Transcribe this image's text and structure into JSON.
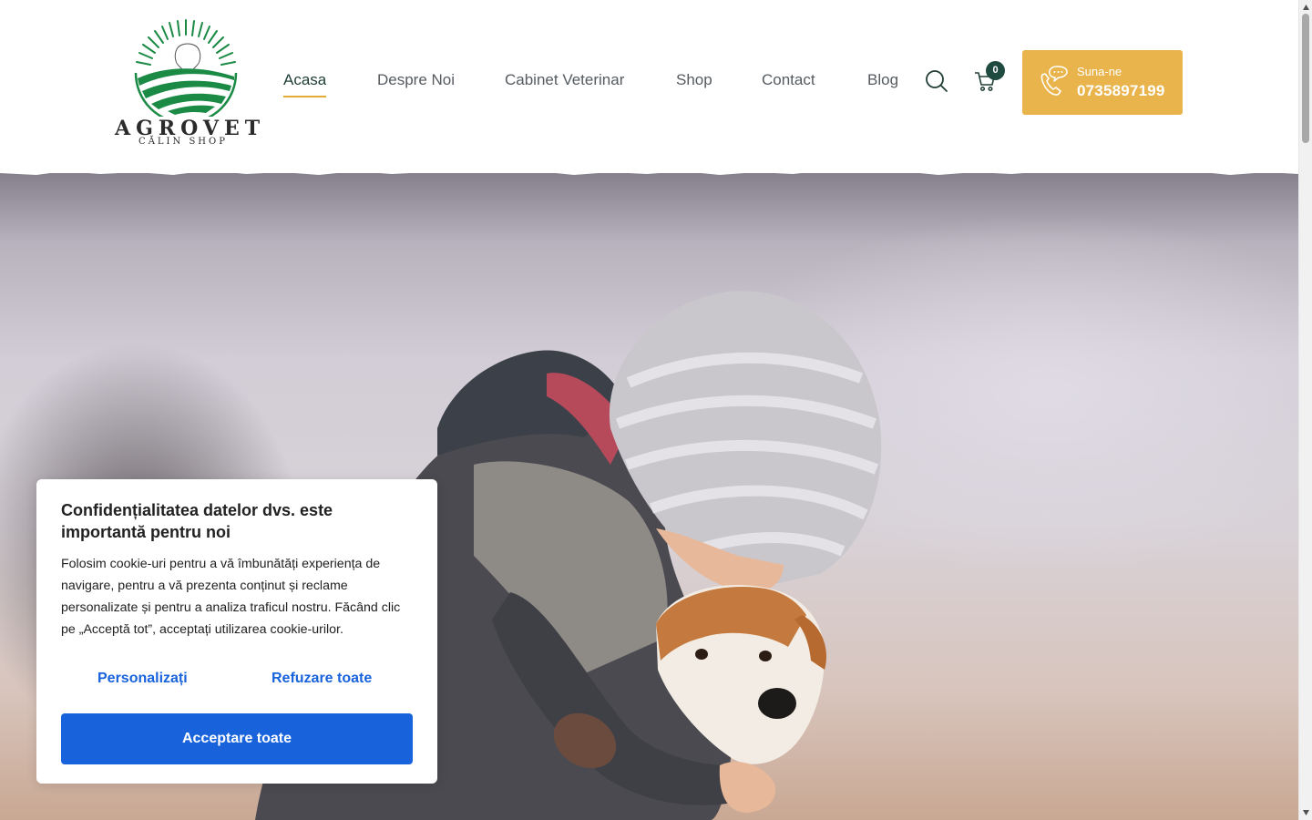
{
  "logo": {
    "word": "AGROVET",
    "sub": "CĂLIN SHOP"
  },
  "nav": {
    "items": [
      {
        "label": "Acasa",
        "active": true
      },
      {
        "label": "Despre Noi",
        "active": false
      },
      {
        "label": "Cabinet Veterinar",
        "active": false
      },
      {
        "label": "Shop",
        "active": false
      },
      {
        "label": "Contact",
        "active": false
      },
      {
        "label": "Blog",
        "active": false
      }
    ]
  },
  "cart": {
    "count": "0"
  },
  "call": {
    "label": "Suna-ne",
    "number": "0735897199"
  },
  "cookie": {
    "title": "Confidențialitatea datelor dvs. este importantă pentru noi",
    "text": "Folosim cookie-uri pentru a vă îmbunătăți experiența de navigare, pentru a vă prezenta conținut și reclame personalizate și pentru a analiza traficul nostru. Făcând clic pe „Acceptă tot”, acceptați utilizarea cookie-urilor.",
    "customize_label": "Personalizați",
    "reject_label": "Refuzare toate",
    "accept_label": "Acceptare toate"
  },
  "colors": {
    "brand_green": "#1a8a45",
    "accent_gold": "#e9b44c",
    "cookie_blue": "#1863dc",
    "badge_green": "#1f4a40"
  },
  "icons": [
    "search-icon",
    "cart-icon",
    "phone-chat-icon",
    "logo-emblem"
  ]
}
